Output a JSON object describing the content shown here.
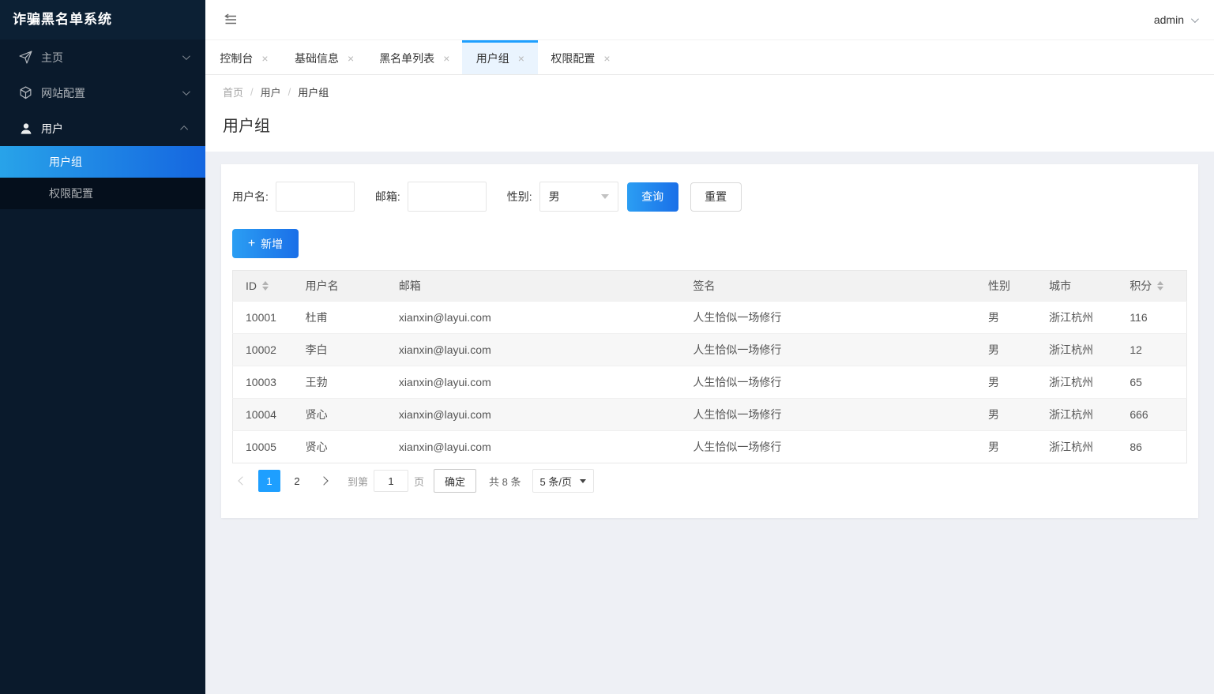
{
  "app": {
    "title": "诈骗黑名单系统",
    "user": "admin"
  },
  "icons": {
    "close": "×",
    "plus": "+",
    "home": "send-icon",
    "site_config": "cube-icon",
    "user": "user-icon",
    "collapse": "outdent-menu-icon",
    "dropdown": "chevron-down-icon",
    "sort": "sort-arrows-icon"
  },
  "sidebar": {
    "items": [
      {
        "label": "主页",
        "state": "collapsed"
      },
      {
        "label": "网站配置",
        "state": "collapsed"
      },
      {
        "label": "用户",
        "state": "expanded",
        "children": [
          {
            "label": "用户组",
            "active": true
          },
          {
            "label": "权限配置",
            "active": false
          }
        ]
      }
    ]
  },
  "tabs": [
    {
      "label": "控制台",
      "active": false
    },
    {
      "label": "基础信息",
      "active": false
    },
    {
      "label": "黑名单列表",
      "active": false
    },
    {
      "label": "用户组",
      "active": true
    },
    {
      "label": "权限配置",
      "active": false
    }
  ],
  "breadcrumb": {
    "separator": "/",
    "items": [
      "首页",
      "用户",
      "用户组"
    ]
  },
  "page": {
    "title": "用户组"
  },
  "filters": {
    "username_label": "用户名:",
    "email_label": "邮箱:",
    "gender_label": "性别:",
    "gender_value": "男",
    "search_label": "查询",
    "reset_label": "重置",
    "add_label": "新增"
  },
  "table": {
    "columns": [
      "ID",
      "用户名",
      "邮箱",
      "签名",
      "性别",
      "城市",
      "积分"
    ],
    "rows": [
      [
        "10001",
        "杜甫",
        "xianxin@layui.com",
        "人生恰似一场修行",
        "男",
        "浙江杭州",
        "116"
      ],
      [
        "10002",
        "李白",
        "xianxin@layui.com",
        "人生恰似一场修行",
        "男",
        "浙江杭州",
        "12"
      ],
      [
        "10003",
        "王勃",
        "xianxin@layui.com",
        "人生恰似一场修行",
        "男",
        "浙江杭州",
        "65"
      ],
      [
        "10004",
        "贤心",
        "xianxin@layui.com",
        "人生恰似一场修行",
        "男",
        "浙江杭州",
        "666"
      ],
      [
        "10005",
        "贤心",
        "xianxin@layui.com",
        "人生恰似一场修行",
        "男",
        "浙江杭州",
        "86"
      ]
    ]
  },
  "pagination": {
    "pages": [
      "1",
      "2"
    ],
    "current": "1",
    "goto_label": "到第",
    "goto_value": "1",
    "page_unit": "页",
    "confirm_label": "确定",
    "total_label": "共 8 条",
    "per_page": "5 条/页"
  },
  "colors": {
    "accent": "#1e9fff",
    "button_gradient_start": "#2b9ef3",
    "button_gradient_end": "#1a6fe8",
    "sidebar_bg": "#0a1a2c",
    "sidebar_logo_bg": "#0c2034",
    "submenu_bg": "#050f1c",
    "active_tab_bg": "#eaf4fe",
    "table_header_bg": "#f2f2f2",
    "row_stripe_bg": "#f7f7f7",
    "content_bg": "#eef0f5"
  }
}
